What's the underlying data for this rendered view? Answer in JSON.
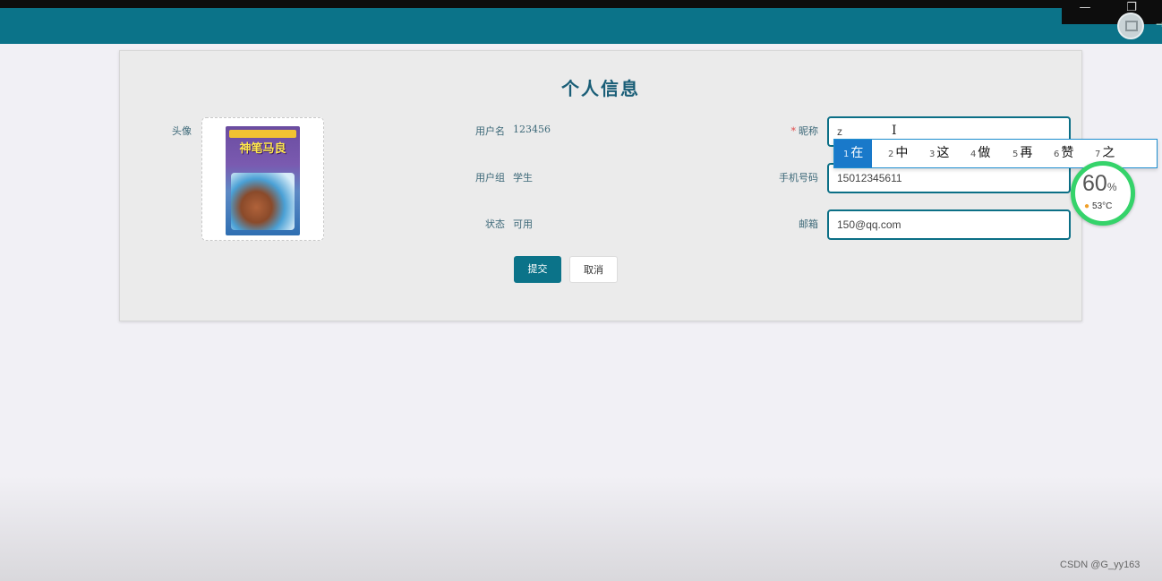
{
  "window": {
    "minimize_glyph": "—",
    "restore_glyph": "❐"
  },
  "header": {
    "avatar_icon": "image-icon",
    "arrow": "→"
  },
  "form": {
    "title": "个人信息",
    "avatar_label": "头像",
    "book_title": "神笔马良",
    "username_label": "用户名",
    "username_value": "123456",
    "group_label": "用户组",
    "group_value": "学生",
    "status_label": "状态",
    "status_value": "可用",
    "nickname_required": "*",
    "nickname_label": "昵称",
    "nickname_value": "z",
    "phone_label": "手机号码",
    "phone_value": "15012345611",
    "email_label": "邮箱",
    "email_value": "150@qq.com",
    "submit_label": "提交",
    "cancel_label": "取消"
  },
  "ime": {
    "candidates": [
      {
        "n": "1",
        "c": "在"
      },
      {
        "n": "2",
        "c": "中"
      },
      {
        "n": "3",
        "c": "这"
      },
      {
        "n": "4",
        "c": "做"
      },
      {
        "n": "5",
        "c": "再"
      },
      {
        "n": "6",
        "c": "赞"
      },
      {
        "n": "7",
        "c": "之"
      }
    ]
  },
  "monitor": {
    "percent": "60",
    "percent_unit": "%",
    "temperature": "53°C",
    "accent_color": "#35d36a"
  },
  "watermark": "CSDN @G_yy163"
}
